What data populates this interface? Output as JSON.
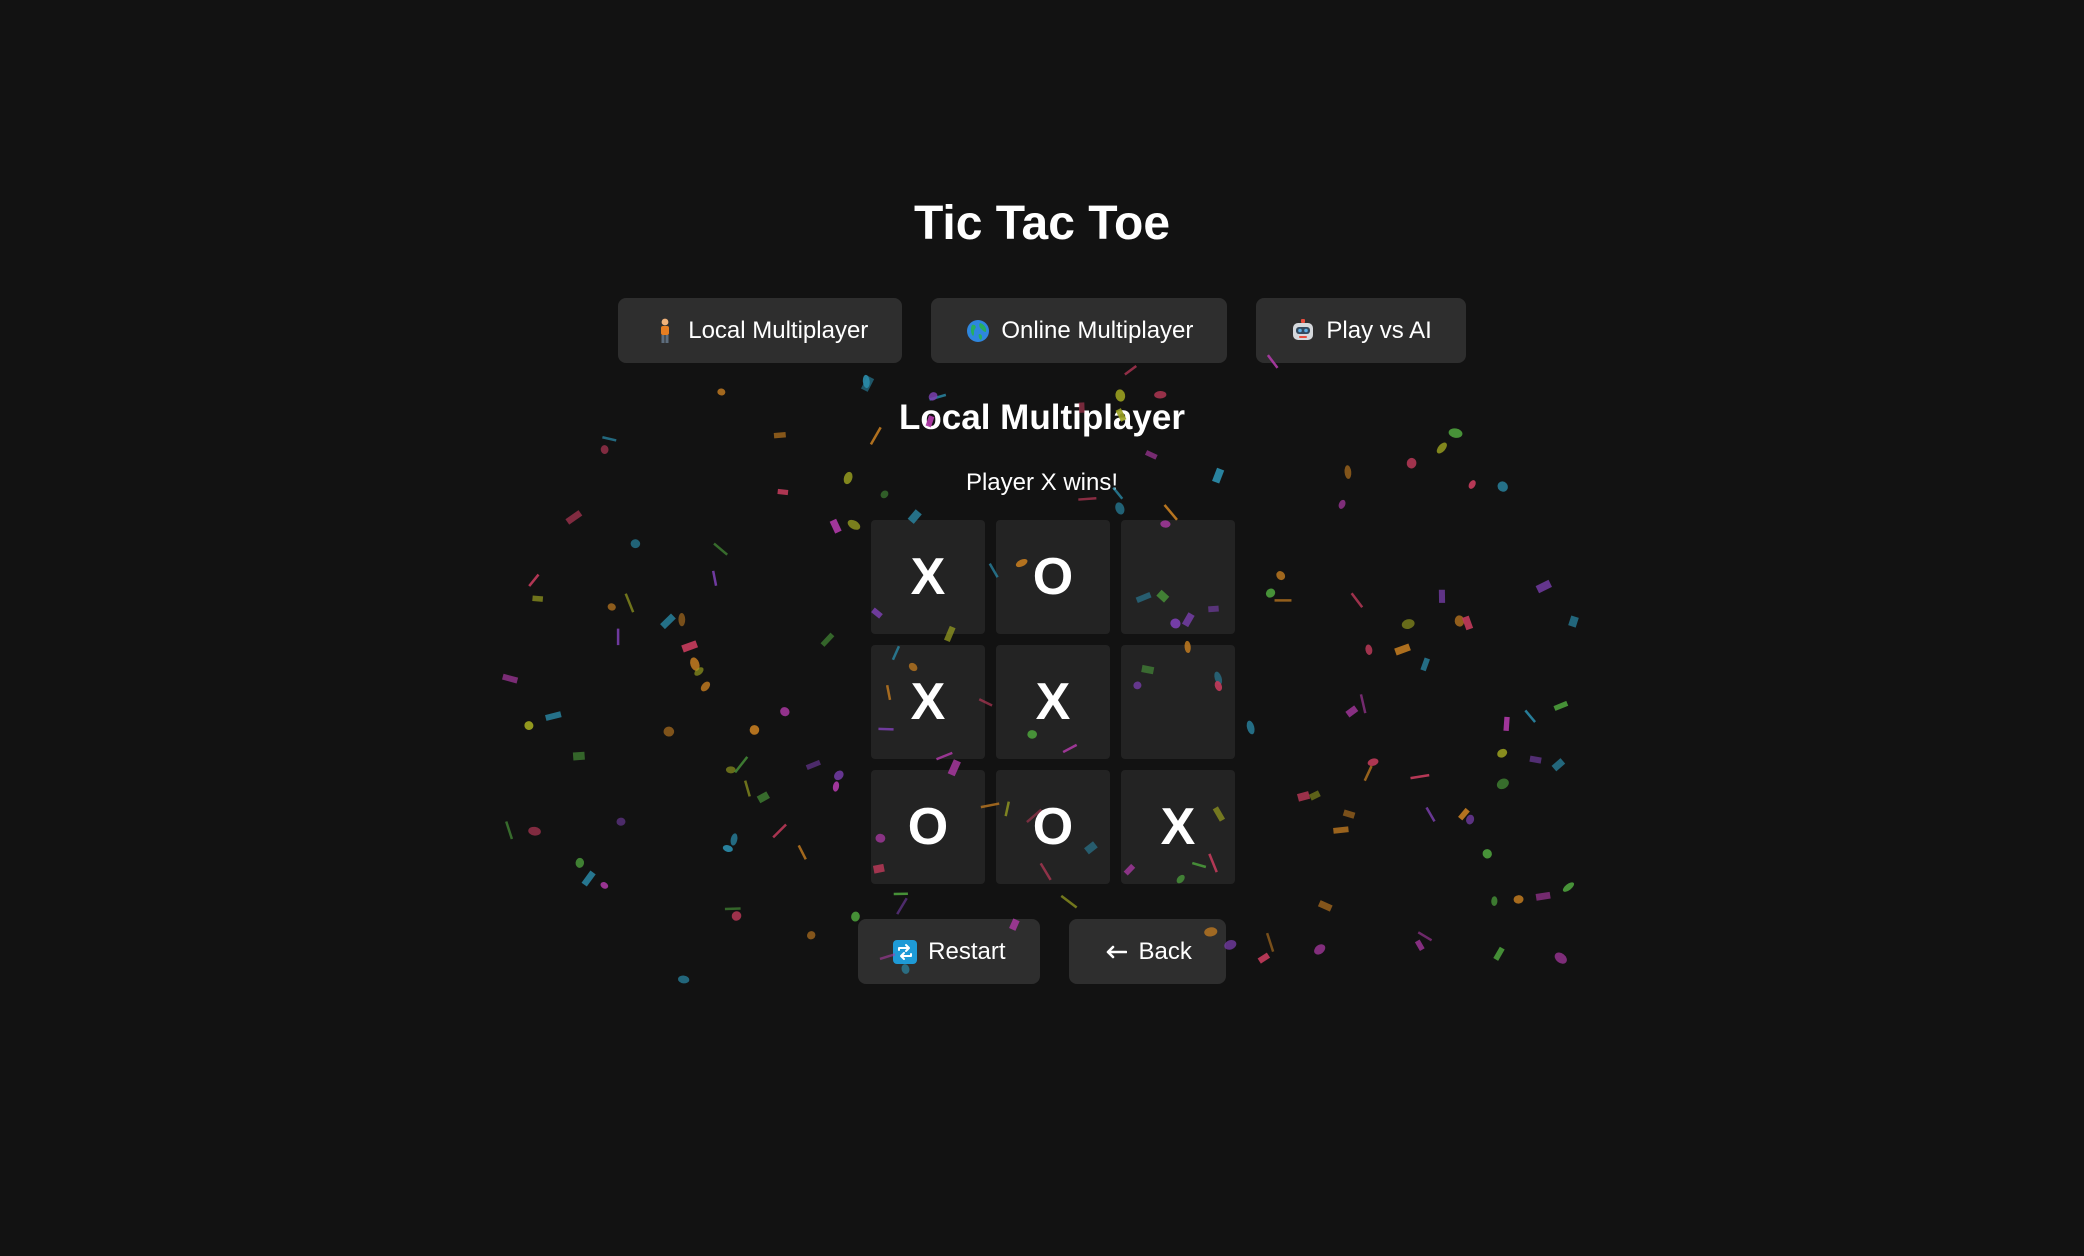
{
  "app": {
    "title": "Tic Tac Toe"
  },
  "modes": [
    {
      "label": "Local Multiplayer",
      "icon": "person-icon"
    },
    {
      "label": "Online Multiplayer",
      "icon": "globe-icon"
    },
    {
      "label": "Play vs AI",
      "icon": "robot-icon"
    }
  ],
  "game": {
    "mode_title": "Local Multiplayer",
    "status": "Player X wins!",
    "board": [
      "X",
      "O",
      "",
      "X",
      "X",
      "",
      "O",
      "O",
      "X"
    ]
  },
  "actions": {
    "restart_label": "Restart",
    "restart_icon": "restart-icon",
    "back_label": "Back",
    "back_icon": "left-arrow-icon"
  },
  "colors": {
    "background": "#121212",
    "button": "#2e2e2e",
    "cell": "#232323",
    "text": "#ffffff",
    "confetti": [
      "#7b3fb0",
      "#2a8aa8",
      "#4a9a3a",
      "#c03a5a",
      "#c07a20",
      "#9aa020",
      "#b03aa8"
    ]
  }
}
